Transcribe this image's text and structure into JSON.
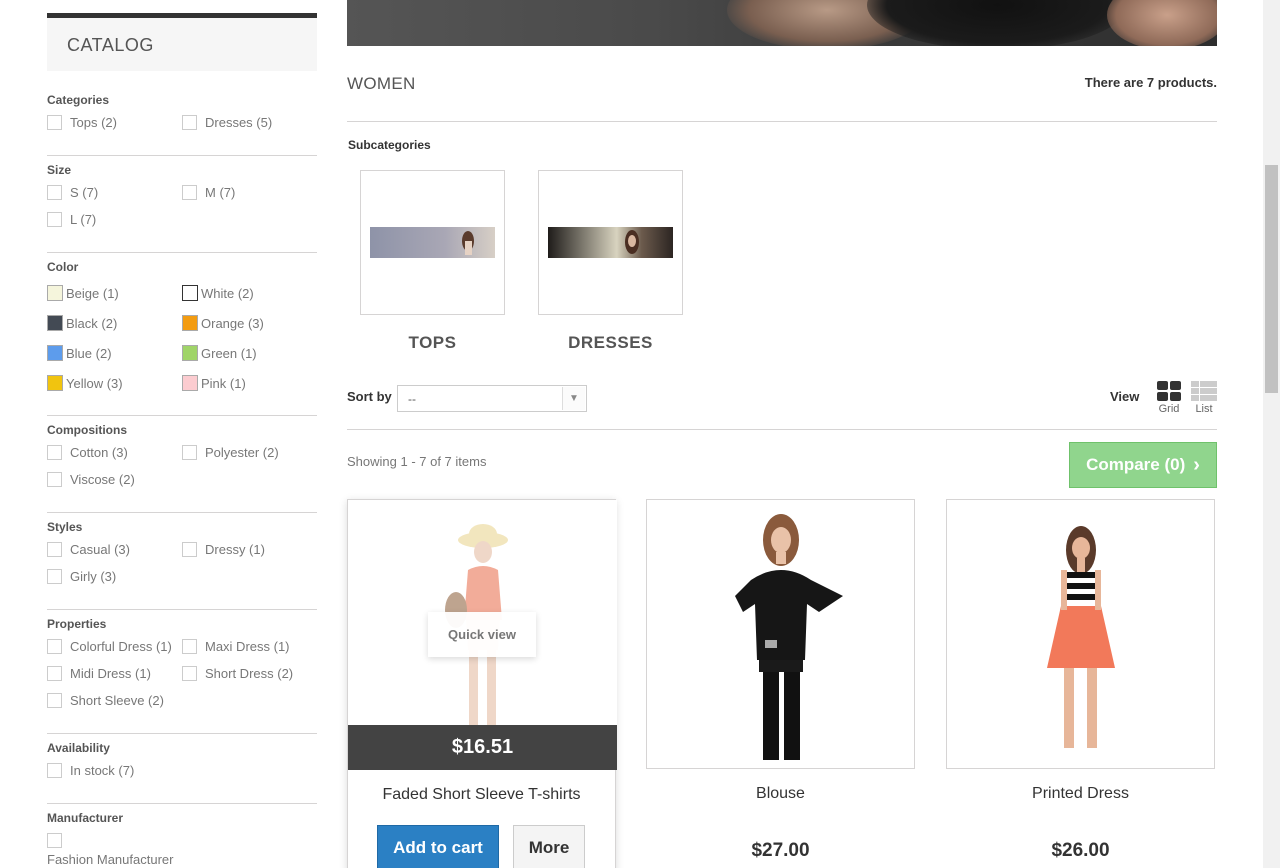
{
  "sidebar": {
    "title": "CATALOG",
    "facets": {
      "categories": {
        "title": "Categories",
        "options": [
          "Tops (2)",
          "Dresses (5)"
        ]
      },
      "size": {
        "title": "Size",
        "options": [
          "S (7)",
          "M (7)",
          "L (7)"
        ]
      },
      "color": {
        "title": "Color",
        "options": [
          {
            "label": "Beige (1)",
            "color": "#f5f5dc"
          },
          {
            "label": "White (2)",
            "color": "#ffffff"
          },
          {
            "label": "Black (2)",
            "color": "#434a54"
          },
          {
            "label": "Orange (3)",
            "color": "#f39c11"
          },
          {
            "label": "Blue (2)",
            "color": "#5d9cec"
          },
          {
            "label": "Green (1)",
            "color": "#a0d468"
          },
          {
            "label": "Yellow (3)",
            "color": "#f1c40f"
          },
          {
            "label": "Pink (1)",
            "color": "#fcccd0"
          }
        ]
      },
      "compositions": {
        "title": "Compositions",
        "options": [
          "Cotton (3)",
          "Polyester (2)",
          "Viscose (2)"
        ]
      },
      "styles": {
        "title": "Styles",
        "options": [
          "Casual (3)",
          "Dressy (1)",
          "Girly (3)"
        ]
      },
      "properties": {
        "title": "Properties",
        "options": [
          "Colorful Dress (1)",
          "Maxi Dress (1)",
          "Midi Dress (1)",
          "Short Dress (2)",
          "Short Sleeve (2)"
        ]
      },
      "availability": {
        "title": "Availability",
        "options": [
          "In stock (7)"
        ]
      },
      "manufacturer": {
        "title": "Manufacturer",
        "options": [
          "Fashion Manufacturer"
        ]
      }
    }
  },
  "main": {
    "category_title": "WOMEN",
    "product_count": "There are 7 products.",
    "subcategories_heading": "Subcategories",
    "subcategories": [
      {
        "name": "TOPS"
      },
      {
        "name": "DRESSES"
      }
    ],
    "sort_label": "Sort by",
    "sort_value": "--",
    "view_label": "View",
    "view_grid": "Grid",
    "view_list": "List",
    "showing": "Showing 1 - 7 of 7 items",
    "compare_button": "Compare (0)",
    "products": [
      {
        "name": "Faded Short Sleeve T-shirts",
        "price": "$16.51",
        "quick_view": "Quick view",
        "add_to_cart": "Add to cart",
        "more": "More"
      },
      {
        "name": "Blouse",
        "price": "$27.00"
      },
      {
        "name": "Printed Dress",
        "price": "$26.00"
      }
    ]
  },
  "colors": {
    "accent_blue": "#2b80c4",
    "compare_green": "#90d58d",
    "dark": "#333333"
  }
}
